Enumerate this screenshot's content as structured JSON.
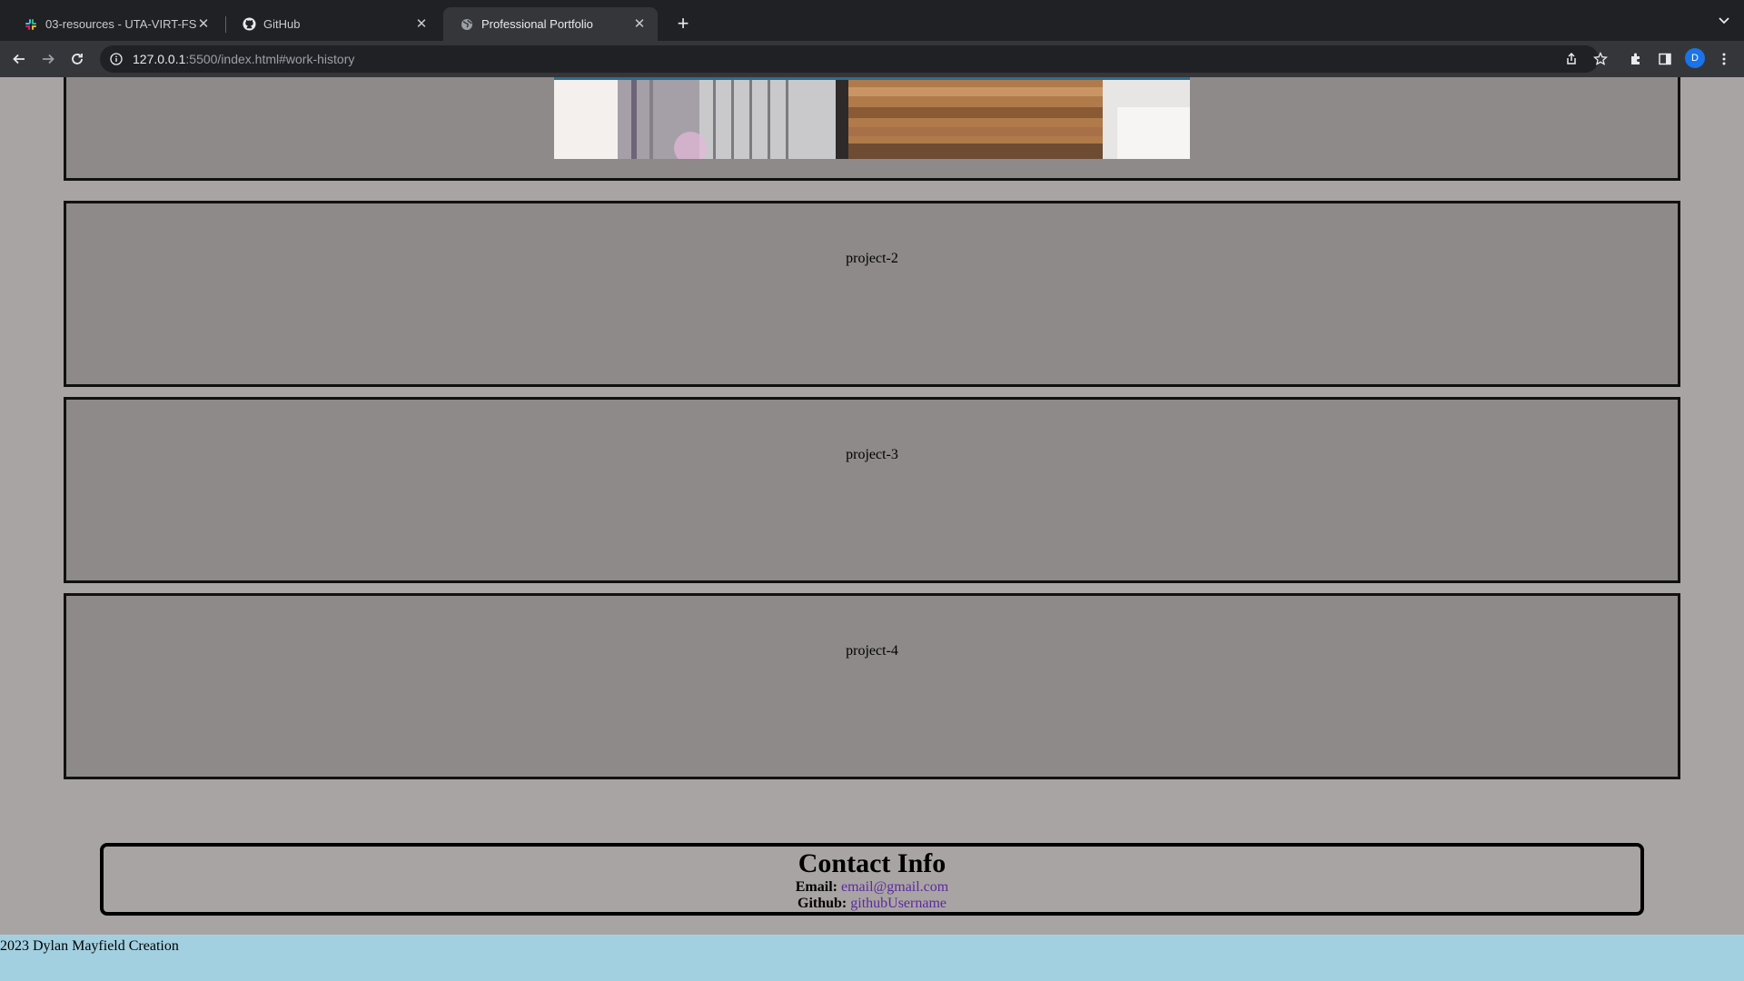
{
  "browser": {
    "tabs": [
      {
        "title": "03-resources - UTA-VIRT-FSF",
        "icon": "slack-icon",
        "active": false
      },
      {
        "title": "GitHub",
        "icon": "github-icon",
        "active": false
      },
      {
        "title": "Professional Portfolio",
        "icon": "globe-icon",
        "active": true
      }
    ],
    "url_host": "127.0.0.1",
    "url_rest": ":5500/index.html#work-history",
    "profile_initial": "D"
  },
  "page": {
    "projects": [
      {
        "label": "project-2"
      },
      {
        "label": "project-3"
      },
      {
        "label": "project-4"
      }
    ],
    "contact": {
      "title": "Contact Info",
      "email_label": "Email:",
      "email_value": "email@gmail.com",
      "github_label": "Github:",
      "github_value": "githubUsername"
    },
    "footer": "2023 Dylan Mayfield Creation"
  },
  "colors": {
    "page_bg": "#a9a4a4",
    "card_bg": "#8e8a8a",
    "footer_bg": "#a3d0e0",
    "link": "#5b2aa0"
  }
}
